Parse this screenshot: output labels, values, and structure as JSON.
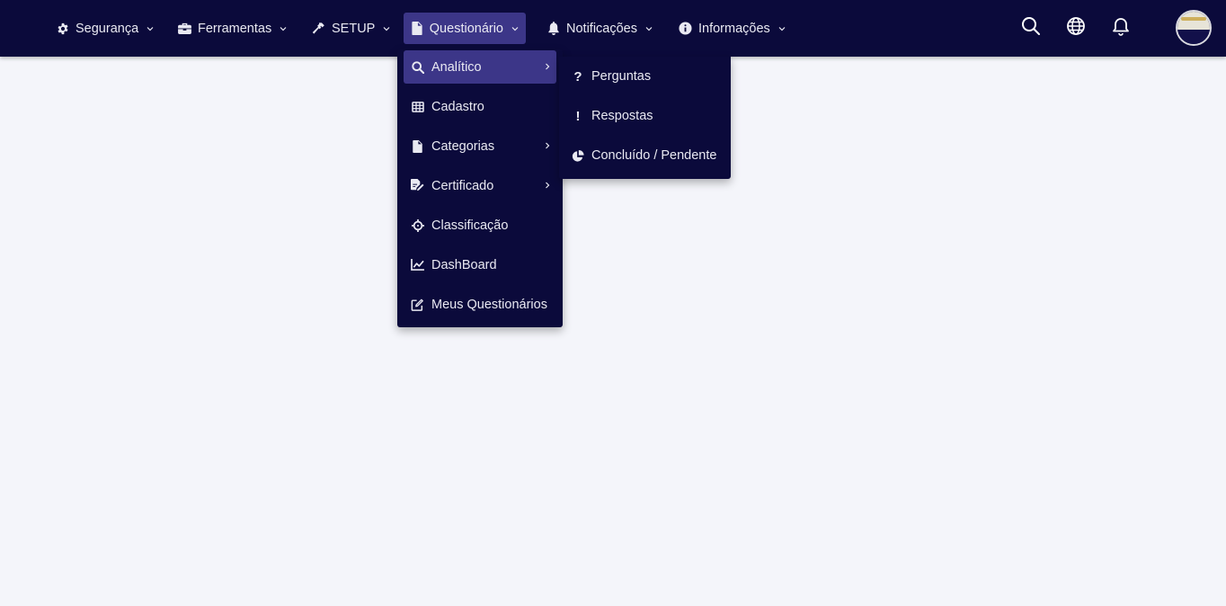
{
  "topnav": {
    "items": [
      {
        "label": "Segurança",
        "icon": "gear-icon"
      },
      {
        "label": "Ferramentas",
        "icon": "toolbox-icon"
      },
      {
        "label": "SETUP",
        "icon": "hammer-icon"
      },
      {
        "label": "Questionário",
        "icon": "file-icon",
        "active": true
      },
      {
        "label": "Notificações",
        "icon": "bell-icon"
      },
      {
        "label": "Informações",
        "icon": "info-icon"
      }
    ],
    "tools": [
      {
        "icon": "search-icon"
      },
      {
        "icon": "globe-icon"
      },
      {
        "icon": "bell-outline-icon"
      }
    ],
    "avatar": {
      "icon": "avatar"
    }
  },
  "questionario_menu": {
    "items": [
      {
        "label": "Analítico",
        "icon": "search-icon",
        "has_submenu": true,
        "active": true
      },
      {
        "label": "Cadastro",
        "icon": "table-icon"
      },
      {
        "label": "Categorias",
        "icon": "file-icon",
        "has_submenu": true
      },
      {
        "label": "Certificado",
        "icon": "certificate-icon",
        "has_submenu": true
      },
      {
        "label": "Classificação",
        "icon": "crosshairs-icon"
      },
      {
        "label": "DashBoard",
        "icon": "chart-line-icon"
      },
      {
        "label": "Meus Questionários",
        "icon": "edit-icon"
      }
    ]
  },
  "analitico_submenu": {
    "items": [
      {
        "label": "Perguntas",
        "glyph": "?",
        "icon": "question-icon"
      },
      {
        "label": "Respostas",
        "glyph": "!",
        "icon": "exclamation-icon"
      },
      {
        "label": "Concluído / Pendente",
        "icon": "pie-chart-icon"
      }
    ]
  },
  "colors": {
    "nav_bg": "#0b0a3b",
    "active_bg": "#3c3688",
    "page_bg": "#f4f5fa",
    "text": "#e9e9f2"
  }
}
